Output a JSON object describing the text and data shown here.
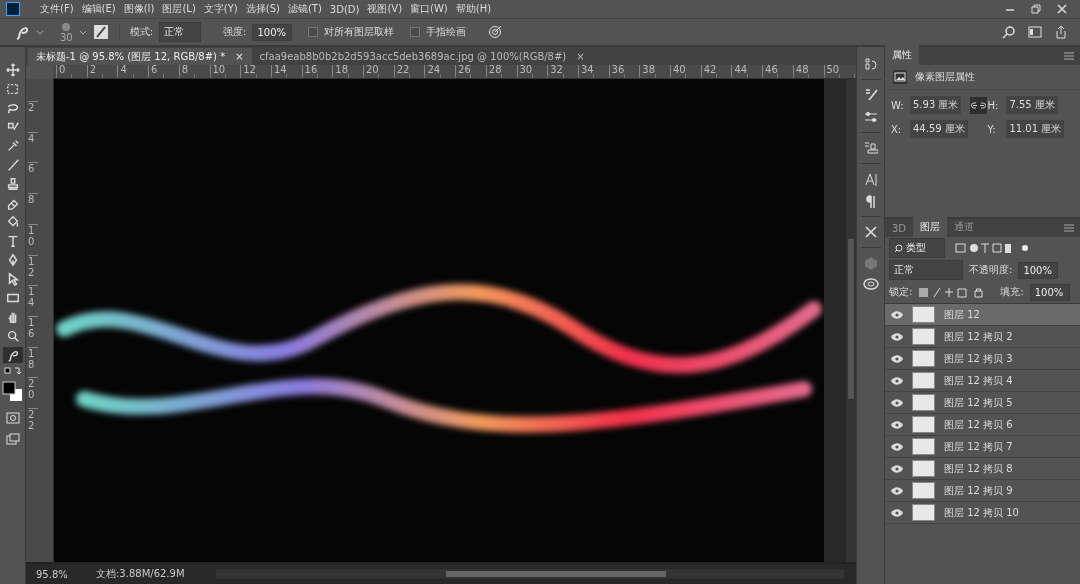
{
  "menu": [
    "文件(F)",
    "编辑(E)",
    "图像(I)",
    "图层(L)",
    "文字(Y)",
    "选择(S)",
    "滤镜(T)",
    "3D(D)",
    "视图(V)",
    "窗口(W)",
    "帮助(H)"
  ],
  "options": {
    "brush_size": "30",
    "mode_label": "模式:",
    "mode": "正常",
    "strength_label": "强度:",
    "strength": "100%",
    "checkboxes": [
      {
        "label": "对所有图层取样",
        "checked": false
      },
      {
        "label": "手指绘画",
        "checked": false
      }
    ]
  },
  "tabs": [
    {
      "label": "未标题-1 @ 95.8% (图层 12, RGB/8#) *",
      "selected": true,
      "close": "×"
    },
    {
      "label": "cfaa9eab8b0b2b2d593acc5deb3689ac.jpg @ 100%(RGB/8#)",
      "selected": false,
      "close": "×"
    }
  ],
  "ruler_h": [
    "0",
    "2",
    "4",
    "6",
    "8",
    "10",
    "12",
    "14",
    "16",
    "18",
    "20",
    "22",
    "24",
    "26",
    "28",
    "30",
    "32",
    "34",
    "36",
    "38",
    "40",
    "42",
    "44",
    "46",
    "48",
    "50"
  ],
  "ruler_v": [
    "2",
    "4",
    "6",
    "8",
    "10",
    "12",
    "14",
    "16",
    "18",
    "20",
    "22"
  ],
  "tools": [
    {
      "kind": "move",
      "selected": false
    },
    {
      "kind": "marquee",
      "selected": false
    },
    {
      "kind": "lasso",
      "selected": false
    },
    {
      "kind": "quickselect",
      "selected": false
    },
    {
      "kind": "eyedropper",
      "selected": false
    },
    {
      "kind": "brush",
      "selected": false
    },
    {
      "kind": "stamp",
      "selected": false
    },
    {
      "kind": "eraser",
      "selected": false
    },
    {
      "kind": "bucket",
      "selected": false
    },
    {
      "kind": "type",
      "selected": false
    },
    {
      "kind": "pen",
      "selected": false
    },
    {
      "kind": "pointer",
      "selected": false
    },
    {
      "kind": "rectangle",
      "selected": false
    },
    {
      "kind": "hand",
      "selected": false
    },
    {
      "kind": "zoom",
      "selected": false
    },
    {
      "kind": "smudge",
      "selected": true
    }
  ],
  "properties": {
    "title": "属性",
    "subtitle": "像素图层属性",
    "fields": [
      {
        "label": "W:",
        "value": "5.93 厘米"
      },
      {
        "label": "H:",
        "value": "7.55 厘米"
      },
      {
        "label": "X:",
        "value": "44.59 厘米"
      },
      {
        "label": "Y:",
        "value": "11.01 厘米"
      }
    ]
  },
  "layers_panel": {
    "tabs": [
      {
        "label": "3D",
        "selected": false
      },
      {
        "label": "图层",
        "selected": true
      },
      {
        "label": "通道",
        "selected": false
      }
    ],
    "filter": "类型",
    "blend": "正常",
    "opacity_label": "不透明度:",
    "opacity": "100%",
    "lock_label": "锁定:",
    "fill_label": "填充:",
    "fill": "100%",
    "layers": [
      {
        "name": "图层 12",
        "visible": true,
        "selected": true
      },
      {
        "name": "图层 12 拷贝 2",
        "visible": true,
        "selected": false
      },
      {
        "name": "图层 12 拷贝 3",
        "visible": true,
        "selected": false
      },
      {
        "name": "图层 12 拷贝 4",
        "visible": true,
        "selected": false
      },
      {
        "name": "图层 12 拷贝 5",
        "visible": true,
        "selected": false
      },
      {
        "name": "图层 12 拷贝 6",
        "visible": true,
        "selected": false
      },
      {
        "name": "图层 12 拷贝 7",
        "visible": true,
        "selected": false
      },
      {
        "name": "图层 12 拷贝 8",
        "visible": true,
        "selected": false
      },
      {
        "name": "图层 12 拷贝 9",
        "visible": true,
        "selected": false
      },
      {
        "name": "图层 12 拷贝 10",
        "visible": true,
        "selected": false
      }
    ]
  },
  "status": {
    "zoom": "95.8%",
    "doc": "文档:3.88M/62.9M"
  }
}
